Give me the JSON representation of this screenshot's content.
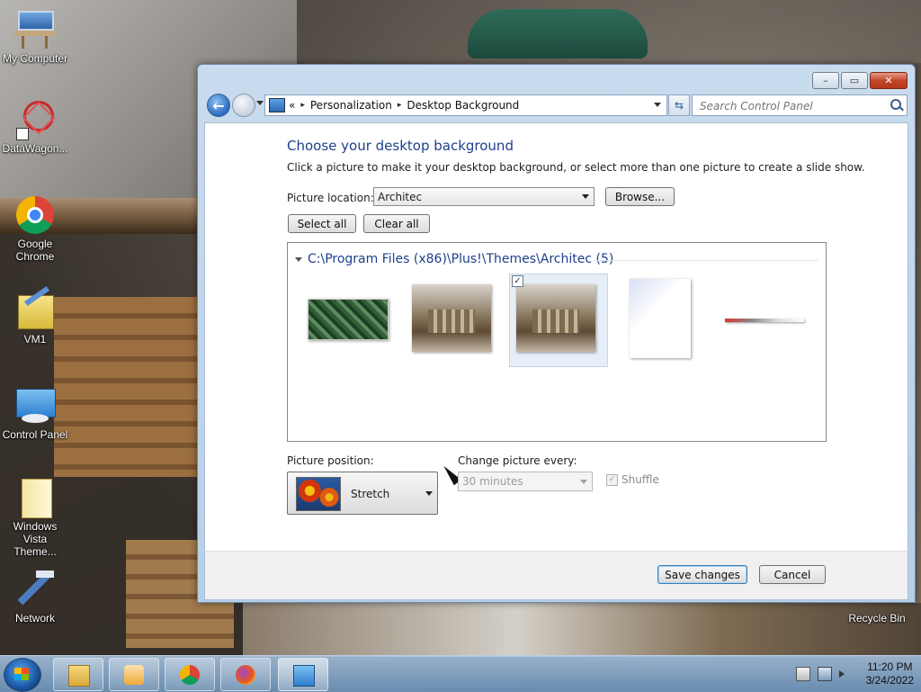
{
  "desktop": {
    "icons": [
      {
        "label": "My Computer"
      },
      {
        "label": "DataWagon..."
      },
      {
        "label": "Google Chrome"
      },
      {
        "label": "VM1"
      },
      {
        "label": "Control Panel"
      },
      {
        "label": "Windows Vista Theme..."
      },
      {
        "label": "Network"
      },
      {
        "label": "Recycle Bin"
      }
    ]
  },
  "window": {
    "controls": {
      "minimize": "–",
      "maximize": "▭",
      "close": "✕"
    },
    "address": {
      "prefix": "«",
      "crumbs": [
        "Personalization",
        "Desktop Background"
      ],
      "separator": "▸"
    },
    "search": {
      "placeholder": "Search Control Panel"
    },
    "heading": "Choose your desktop background",
    "subtitle": "Click a picture to make it your desktop background, or select more than one picture to create a slide show.",
    "picture_location": {
      "label": "Picture location:",
      "value": "Architec"
    },
    "browse_label": "Browse...",
    "select_all_label": "Select all",
    "clear_all_label": "Clear all",
    "gallery": {
      "group_label": "C:\\Program Files (x86)\\Plus!\\Themes\\Architec (5)",
      "selected_index": 2,
      "check_mark": "✓"
    },
    "picture_position": {
      "label": "Picture position:",
      "value": "Stretch"
    },
    "change_picture": {
      "label": "Change picture every:",
      "value": "30 minutes"
    },
    "shuffle": {
      "label": "Shuffle",
      "check_mark": "✓"
    },
    "save_label": "Save changes",
    "cancel_label": "Cancel"
  },
  "taskbar": {
    "time": "11:20 PM",
    "date": "3/24/2022"
  }
}
